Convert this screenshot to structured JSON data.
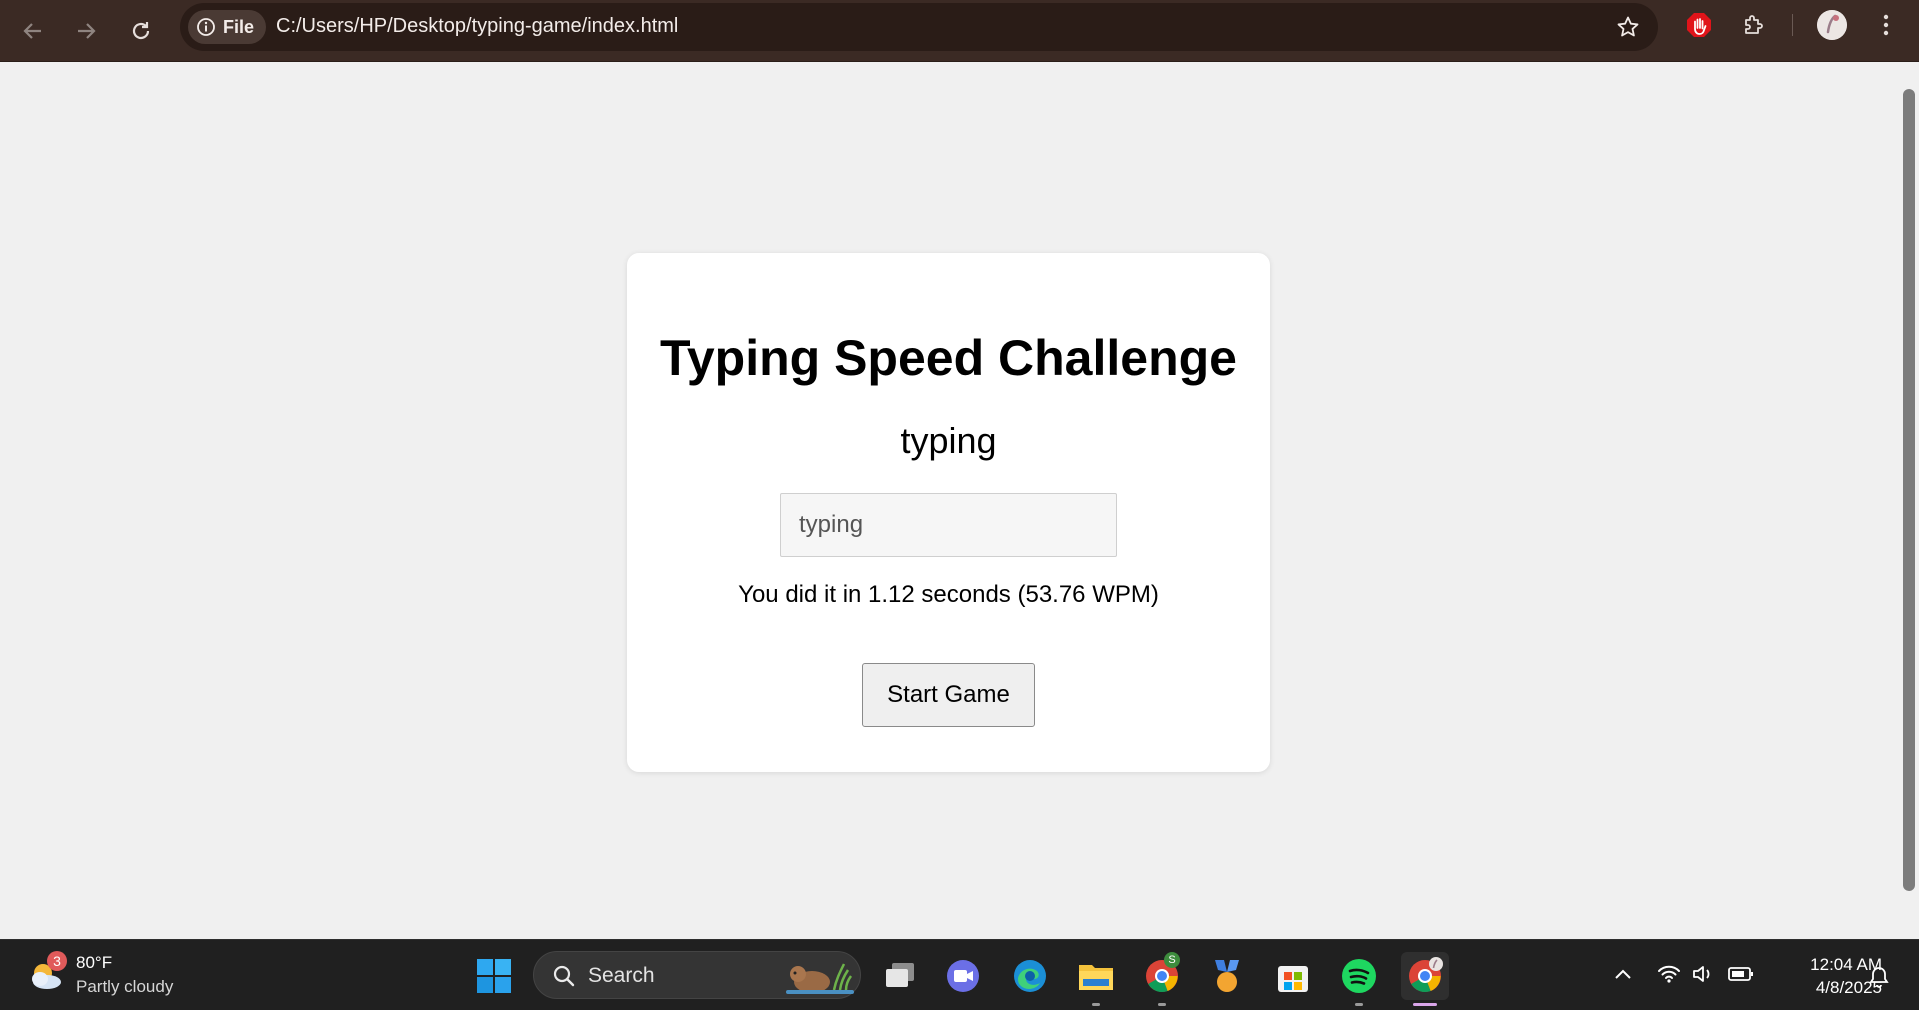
{
  "browser": {
    "site_chip_label": "File",
    "url": "C:/Users/HP/Desktop/typing-game/index.html"
  },
  "page": {
    "title": "Typing Speed Challenge",
    "target_word": "typing",
    "input_value": "typing",
    "result": "You did it in 1.12 seconds (53.76 WPM)",
    "start_button": "Start Game"
  },
  "taskbar": {
    "weather_temp": "80°F",
    "weather_desc": "Partly cloudy",
    "weather_badge": "3",
    "search_label": "Search",
    "chrome_badge": "S",
    "time": "12:04 AM",
    "date": "4/8/2025"
  },
  "colors": {
    "toolbar": "#3b2a24",
    "page_background": "#f0f0f0",
    "card": "#ffffff",
    "taskbar": "#202020"
  }
}
